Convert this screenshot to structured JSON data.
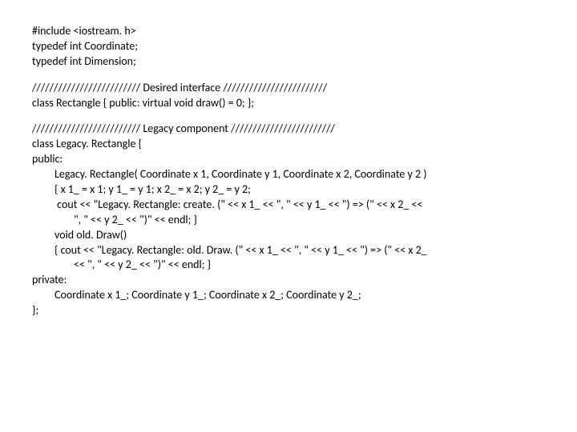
{
  "header": {
    "l1": "#include <iostream. h>",
    "l2": "typedef int Coordinate;",
    "l3": "typedef int Dimension;"
  },
  "section1": {
    "title": "///////////////////////// Desired interface ////////////////////////",
    "l1": "class Rectangle { public: virtual void draw() = 0; };"
  },
  "section2": {
    "title": "///////////////////////// Legacy component ////////////////////////",
    "l1": "class Legacy. Rectangle {",
    "l2": "public:",
    "l3": "Legacy. Rectangle( Coordinate x 1, Coordinate y 1, Coordinate x 2, Coordinate y 2 )",
    "l4": "{ x 1_ = x 1; y 1_ = y 1; x 2_ = x 2; y 2_ = y 2;",
    "l5": " cout << \"Legacy. Rectangle: create. (\" << x 1_ << \", \" << y 1_ << \") => (\" << x 2_ <<",
    "l6": "\", \" << y 2_ << \")\" << endl; }",
    "l7": "void old. Draw()",
    "l8": "{ cout << \"Legacy. Rectangle: old. Draw. (\" << x 1_ << \", \" << y 1_ << \") => (\" << x 2_",
    "l9": "<< \", \" << y 2_ << \")\" << endl; }",
    "l10": "private:",
    "l11": "Coordinate x 1_; Coordinate y 1_; Coordinate x 2_; Coordinate y 2_;",
    "l12": "};"
  }
}
